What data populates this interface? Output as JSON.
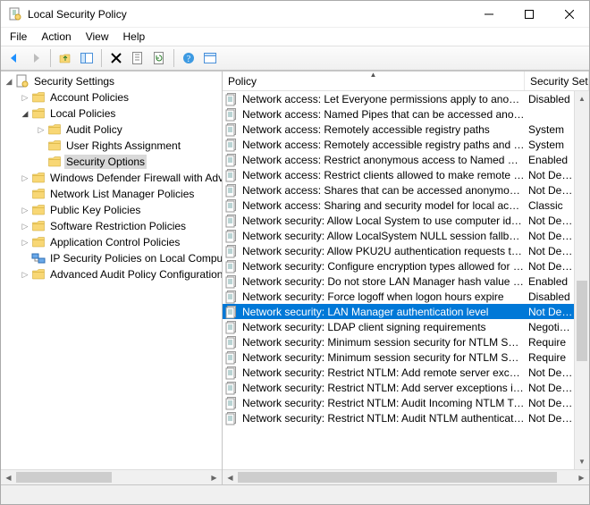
{
  "window": {
    "title": "Local Security Policy"
  },
  "menu": [
    "File",
    "Action",
    "View",
    "Help"
  ],
  "tree": {
    "root": "Security Settings",
    "nodes": [
      {
        "label": "Account Policies",
        "depth": 1,
        "exp": "▷",
        "icon": "folder"
      },
      {
        "label": "Local Policies",
        "depth": 1,
        "exp": "◢",
        "icon": "folder"
      },
      {
        "label": "Audit Policy",
        "depth": 2,
        "exp": "▷",
        "icon": "folder"
      },
      {
        "label": "User Rights Assignment",
        "depth": 2,
        "exp": "",
        "icon": "folder"
      },
      {
        "label": "Security Options",
        "depth": 2,
        "exp": "",
        "icon": "folder",
        "sel": true
      },
      {
        "label": "Windows Defender Firewall with Advanced Security",
        "depth": 1,
        "exp": "▷",
        "icon": "folder"
      },
      {
        "label": "Network List Manager Policies",
        "depth": 1,
        "exp": "",
        "icon": "folder"
      },
      {
        "label": "Public Key Policies",
        "depth": 1,
        "exp": "▷",
        "icon": "folder"
      },
      {
        "label": "Software Restriction Policies",
        "depth": 1,
        "exp": "▷",
        "icon": "folder"
      },
      {
        "label": "Application Control Policies",
        "depth": 1,
        "exp": "▷",
        "icon": "folder"
      },
      {
        "label": "IP Security Policies on Local Computer",
        "depth": 1,
        "exp": "",
        "icon": "ipsec"
      },
      {
        "label": "Advanced Audit Policy Configuration",
        "depth": 1,
        "exp": "▷",
        "icon": "folder"
      }
    ]
  },
  "list": {
    "col_policy": "Policy",
    "col_setting": "Security Setting",
    "rows": [
      {
        "policy": "Network access: Let Everyone permissions apply to anonym...",
        "setting": "Disabled"
      },
      {
        "policy": "Network access: Named Pipes that can be accessed anonym...",
        "setting": ""
      },
      {
        "policy": "Network access: Remotely accessible registry paths",
        "setting": "System"
      },
      {
        "policy": "Network access: Remotely accessible registry paths and sub...",
        "setting": "System"
      },
      {
        "policy": "Network access: Restrict anonymous access to Named Pipes...",
        "setting": "Enabled"
      },
      {
        "policy": "Network access: Restrict clients allowed to make remote call...",
        "setting": "Not Defined"
      },
      {
        "policy": "Network access: Shares that can be accessed anonymously",
        "setting": "Not Defined"
      },
      {
        "policy": "Network access: Sharing and security model for local accou...",
        "setting": "Classic"
      },
      {
        "policy": "Network security: Allow Local System to use computer ident...",
        "setting": "Not Defined"
      },
      {
        "policy": "Network security: Allow LocalSystem NULL session fallback",
        "setting": "Not Defined"
      },
      {
        "policy": "Network security: Allow PKU2U authentication requests to t...",
        "setting": "Not Defined"
      },
      {
        "policy": "Network security: Configure encryption types allowed for Ke...",
        "setting": "Not Defined"
      },
      {
        "policy": "Network security: Do not store LAN Manager hash value on ...",
        "setting": "Enabled"
      },
      {
        "policy": "Network security: Force logoff when logon hours expire",
        "setting": "Disabled"
      },
      {
        "policy": "Network security: LAN Manager authentication level",
        "setting": "Not Defined",
        "sel": true
      },
      {
        "policy": "Network security: LDAP client signing requirements",
        "setting": "Negotiate"
      },
      {
        "policy": "Network security: Minimum session security for NTLM SSP ...",
        "setting": "Require"
      },
      {
        "policy": "Network security: Minimum session security for NTLM SSP ...",
        "setting": "Require"
      },
      {
        "policy": "Network security: Restrict NTLM: Add remote server excepti...",
        "setting": "Not Defined"
      },
      {
        "policy": "Network security: Restrict NTLM: Add server exceptions in t...",
        "setting": "Not Defined"
      },
      {
        "policy": "Network security: Restrict NTLM: Audit Incoming NTLM Traf...",
        "setting": "Not Defined"
      },
      {
        "policy": "Network security: Restrict NTLM: Audit NTLM authentication...",
        "setting": "Not Defined"
      }
    ]
  }
}
